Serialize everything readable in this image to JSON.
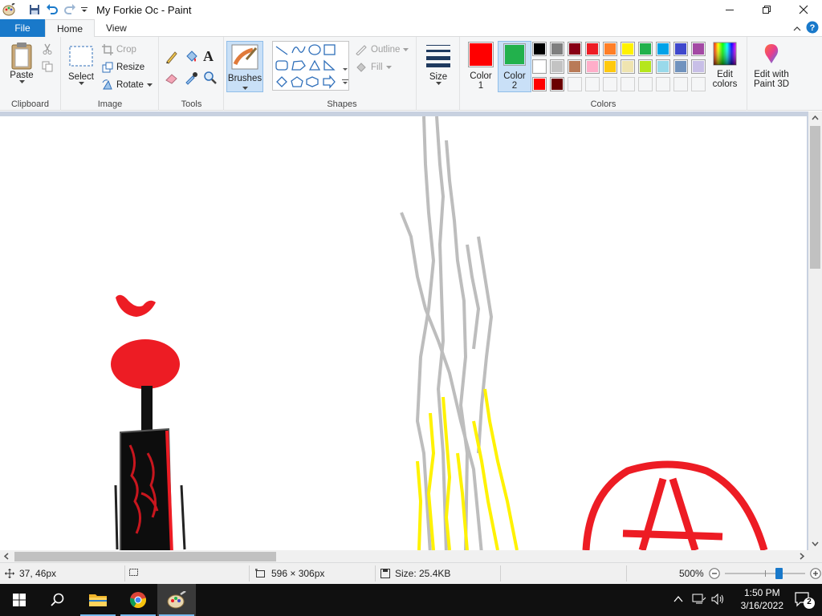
{
  "window": {
    "title": "My Forkie Oc - Paint"
  },
  "tabs": {
    "file": "File",
    "home": "Home",
    "view": "View"
  },
  "clipboard": {
    "paste": "Paste",
    "label": "Clipboard"
  },
  "image": {
    "select": "Select",
    "crop": "Crop",
    "resize": "Resize",
    "rotate": "Rotate",
    "label": "Image"
  },
  "tools": {
    "label": "Tools",
    "text_glyph": "A"
  },
  "brushes": {
    "label": "Brushes"
  },
  "shapes": {
    "outline": "Outline",
    "fill": "Fill",
    "label": "Shapes"
  },
  "size": {
    "label": "Size"
  },
  "colors": {
    "color1_l1": "Color",
    "color1_l2": "1",
    "color2_l1": "Color",
    "color2_l2": "2",
    "color1_value": "#ff0000",
    "color2_value": "#22b14c",
    "edit_l1": "Edit",
    "edit_l2": "colors",
    "paint3d_l1": "Edit with",
    "paint3d_l2": "Paint 3D",
    "label": "Colors",
    "palette_row1": [
      "#000000",
      "#7f7f7f",
      "#880015",
      "#ed1c24",
      "#ff7f27",
      "#fff200",
      "#22b14c",
      "#00a2e8",
      "#3f48cc",
      "#a349a4"
    ],
    "palette_row2": [
      "#ffffff",
      "#c3c3c3",
      "#b97a57",
      "#ffaec9",
      "#ffc90e",
      "#efe4b0",
      "#b5e61d",
      "#99d9ea",
      "#7092be",
      "#c8bfe7"
    ],
    "palette_row3": [
      "#ff0000",
      "#6b0000",
      "",
      "",
      "",
      "",
      "",
      "",
      "",
      ""
    ]
  },
  "status": {
    "cursor_pos": "37, 46px",
    "selection_size": "596 × 306px",
    "file_size": "Size: 25.4KB",
    "zoom": "500%",
    "zoom_fraction": 0.7
  },
  "taskbar": {
    "time": "1:50 PM",
    "date": "3/16/2022",
    "notifications": "2"
  }
}
